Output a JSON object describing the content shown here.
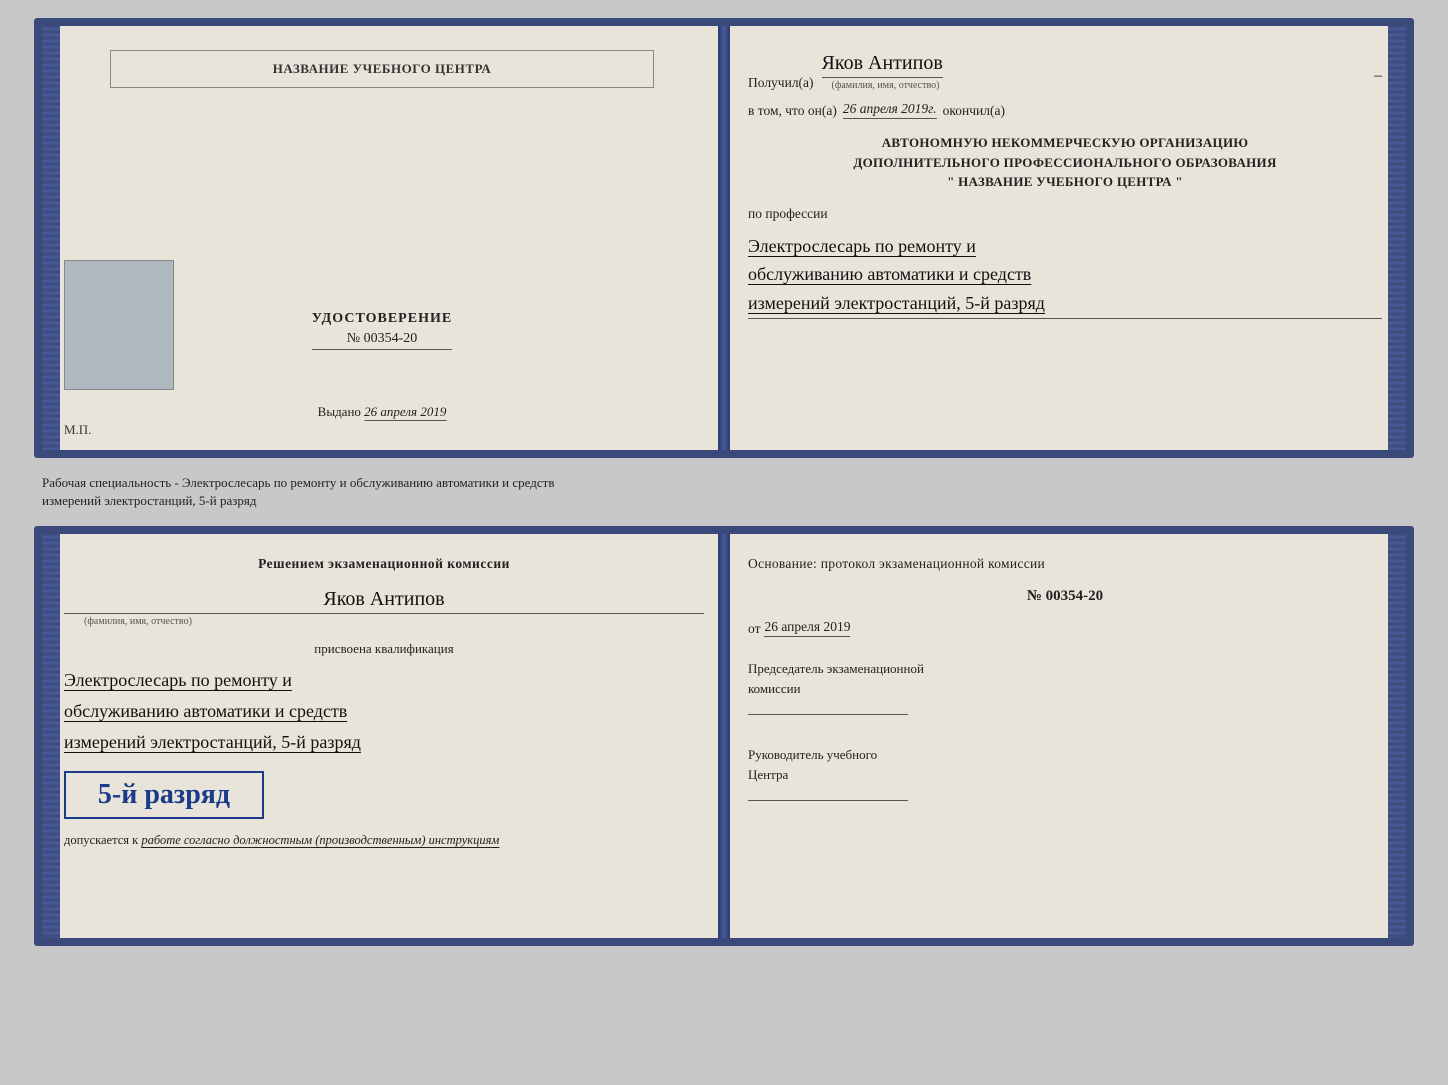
{
  "topDoc": {
    "left": {
      "orgNameLabel": "НАЗВАНИЕ УЧЕБНОГО ЦЕНТРА",
      "certTitle": "УДОСТОВЕРЕНИЕ",
      "certNumber": "№ 00354-20",
      "vydanoLabel": "Выдано",
      "vydanoDate": "26 апреля 2019",
      "mpLabel": "М.П."
    },
    "right": {
      "poluchilLabel": "Получил(а)",
      "recipientName": "Яков Антипов",
      "dashSymbol": "–",
      "fioSubLabel": "(фамилия, имя, отчество)",
      "vtomLabel": "в том, что он(а)",
      "vtomDate": "26 апреля 2019г.",
      "okoncilLabel": "окончил(а)",
      "orgLine1": "АВТОНОМНУЮ НЕКОММЕРЧЕСКУЮ ОРГАНИЗАЦИЮ",
      "orgLine2": "ДОПОЛНИТЕЛЬНОГО ПРОФЕССИОНАЛЬНОГО ОБРАЗОВАНИЯ",
      "orgLine3": "\" НАЗВАНИЕ УЧЕБНОГО ЦЕНТРА \"",
      "poProfessiiLabel": "по профессии",
      "profLine1": "Электрослесарь по ремонту и",
      "profLine2": "обслуживанию автоматики и средств",
      "profLine3": "измерений электростанций, 5-й разряд"
    }
  },
  "separatorText": "Рабочая специальность - Электрослесарь по ремонту и обслуживанию автоматики и средств\nизмерений электростанций, 5-й разряд",
  "bottomDoc": {
    "left": {
      "resheniemText": "Решением экзаменационной комиссии",
      "fioName": "Яков Антипов",
      "fioSubLabel": "(фамилия, имя, отчество)",
      "prisvoenaText": "присвоена квалификация",
      "qualLine1": "Электрослесарь по ремонту и",
      "qualLine2": "обслуживанию автоматики и средств",
      "qualLine3": "измерений электростанций, 5-й разряд",
      "razryadBadge": "5-й разряд",
      "dopuskaetsyaLabel": "допускается к",
      "dopuskaetsyaText": "работе согласно должностным (производственным) инструкциям"
    },
    "right": {
      "osnovanieText": "Основание: протокол экзаменационной комиссии",
      "protocolNumber": "№ 00354-20",
      "otLabel": "от",
      "otDate": "26 апреля 2019",
      "predsedatelLabel": "Председатель экзаменационной\nкомиссии",
      "rukovoditelLabel": "Руководитель учебного\nЦентра"
    }
  }
}
